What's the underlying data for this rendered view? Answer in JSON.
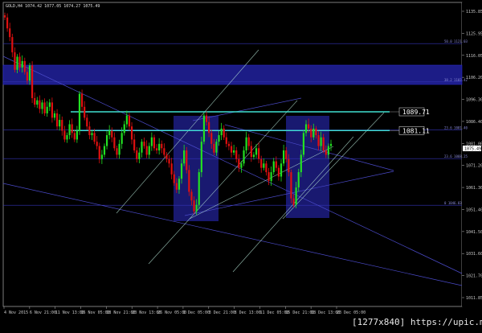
{
  "chart_title": "GOLD,H4  1074.42 1077.05 1074.27 1075.49",
  "watermark": "[1277x840] https://upic.me/",
  "chart_data": {
    "type": "candlestick",
    "title": "GOLD,H4  1074.42 1077.05 1074.27 1075.49",
    "ylim": [
      1004.45,
      1135.85
    ],
    "y_ticks": [
      "1135.85",
      "1125.95",
      "1116.05",
      "1106.20",
      "1096.30",
      "1086.40",
      "1081.00",
      "1071.20",
      "1061.30",
      "1051.40",
      "1041.50",
      "1031.60",
      "1021.70",
      "1011.85"
    ],
    "x_ticks": [
      "4 Nov 2015",
      "6 Nov 21:00",
      "11 Nov 13:00",
      "16 Nov 05:00",
      "18 Nov 21:00",
      "23 Nov 13:00",
      "26 Nov 05:00",
      "1 Dec 05:00",
      "3 Dec 21:00",
      "8 Dec 13:00",
      "11 Dec 05:00",
      "15 Dec 21:00",
      "18 Dec 13:00",
      "23 Dec 05:00"
    ],
    "current_price": "1075.49",
    "horizontal_levels": [
      {
        "label": "1089.71",
        "value": 1089.71,
        "color": "#40e0d0"
      },
      {
        "label": "1081.11",
        "value": 1081.11,
        "color": "#40e0d0"
      }
    ],
    "fib_levels": [
      {
        "label": "50.0 1121.03",
        "value": 1121.03
      },
      {
        "label": "38.2 1103.42",
        "value": 1103.42
      },
      {
        "label": "23.6 1081.40",
        "value": 1081.4
      },
      {
        "label": "23.6 1068.25",
        "value": 1068.25
      },
      {
        "label": "0 1046.83",
        "value": 1046.83
      }
    ],
    "closes": [
      1133,
      1128,
      1124,
      1117,
      1109,
      1115,
      1110,
      1113,
      1108,
      1104,
      1111,
      1096,
      1093,
      1095,
      1091,
      1094,
      1089,
      1092,
      1094,
      1087,
      1089,
      1083,
      1086,
      1081,
      1077,
      1079,
      1084,
      1080,
      1077,
      1081,
      1098,
      1092,
      1087,
      1083,
      1079,
      1080,
      1076,
      1074,
      1068,
      1070,
      1074,
      1079,
      1081,
      1078,
      1073,
      1070,
      1075,
      1080,
      1084,
      1088,
      1083,
      1077,
      1072,
      1068,
      1071,
      1076,
      1074,
      1070,
      1074,
      1078,
      1073,
      1072,
      1075,
      1073,
      1070,
      1068,
      1066,
      1061,
      1057,
      1054,
      1059,
      1066,
      1072,
      1063,
      1053,
      1049,
      1044,
      1047,
      1062,
      1076,
      1088,
      1085,
      1080,
      1075,
      1071,
      1076,
      1079,
      1082,
      1078,
      1075,
      1074,
      1071,
      1072,
      1068,
      1064,
      1066,
      1072,
      1078,
      1074,
      1069,
      1070,
      1073,
      1068,
      1064,
      1066,
      1062,
      1058,
      1062,
      1067,
      1064,
      1060,
      1066,
      1072,
      1068,
      1062,
      1050,
      1047,
      1055,
      1062,
      1070,
      1080,
      1084,
      1082,
      1078,
      1082,
      1079,
      1074,
      1078,
      1072,
      1070,
      1074,
      1075
    ]
  }
}
